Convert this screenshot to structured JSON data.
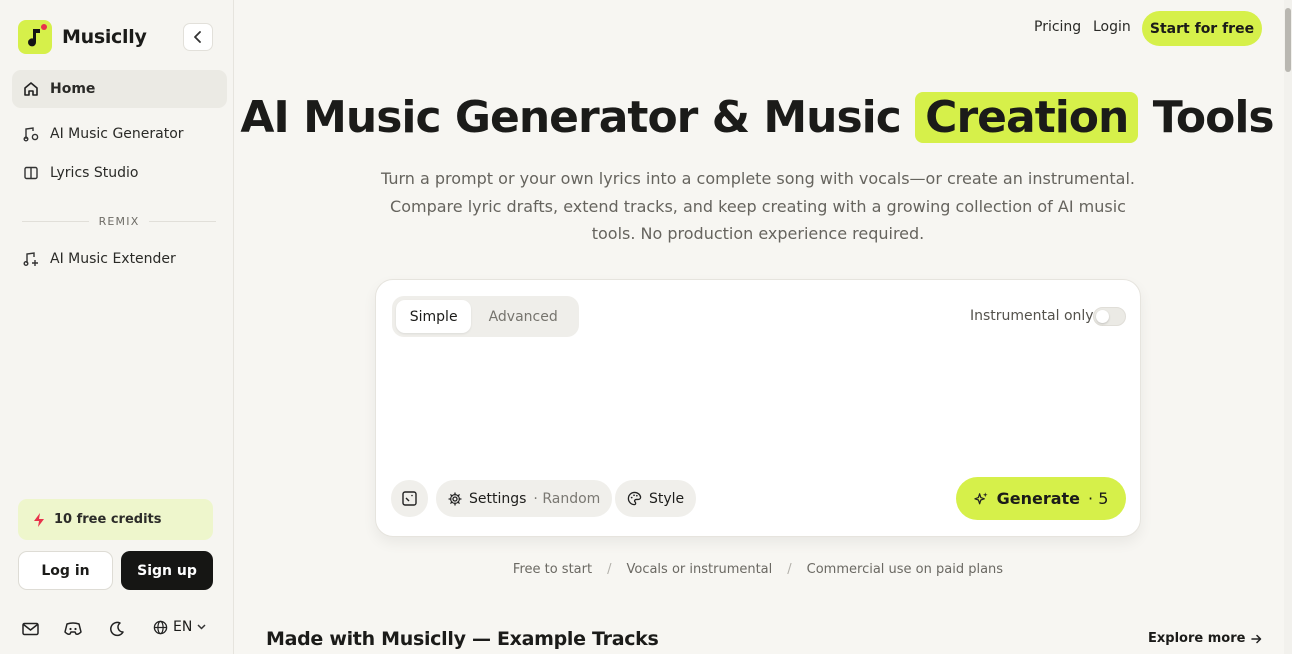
{
  "sidebar": {
    "brand": "Musiclly",
    "nav": [
      {
        "label": "Home",
        "icon": "home-icon",
        "active": true
      },
      {
        "label": "AI Music Generator",
        "icon": "music-generator-icon"
      },
      {
        "label": "Lyrics Studio",
        "icon": "book-icon"
      }
    ],
    "section_label": "REMIX",
    "remix_nav": [
      {
        "label": "AI Music Extender",
        "icon": "music-plus-icon"
      }
    ],
    "credits": "10 free credits",
    "login_label": "Log in",
    "signup_label": "Sign up",
    "language": "EN"
  },
  "header": {
    "pricing": "Pricing",
    "login": "Login",
    "cta": "Start for free"
  },
  "hero": {
    "title_before": "AI Music Generator & Music",
    "title_highlight": "Creation",
    "title_after": "Tools",
    "subtitle": "Turn a prompt or your own lyrics into a complete song with vocals—or create an instrumental. Compare lyric drafts, extend tracks, and keep creating with a growing collection of AI music tools. No production experience required."
  },
  "composer": {
    "mode_simple": "Simple",
    "mode_advanced": "Advanced",
    "instrumental_label": "Instrumental only",
    "instrumental_on": false,
    "prompt_value": "",
    "settings_label": "Settings",
    "settings_value": "· Random",
    "style_label": "Style",
    "generate_label": "Generate",
    "generate_cost": "· 5"
  },
  "features": [
    "Free to start",
    "Vocals or instrumental",
    "Commercial use on paid plans"
  ],
  "feature_separator": "/",
  "examples": {
    "title": "Made with Musiclly — Example Tracks",
    "explore": "Explore more"
  },
  "colors": {
    "accent": "#d6f04a",
    "brand_dot": "#e8324b",
    "background": "#f7f6f2",
    "dark_button": "#161614"
  }
}
